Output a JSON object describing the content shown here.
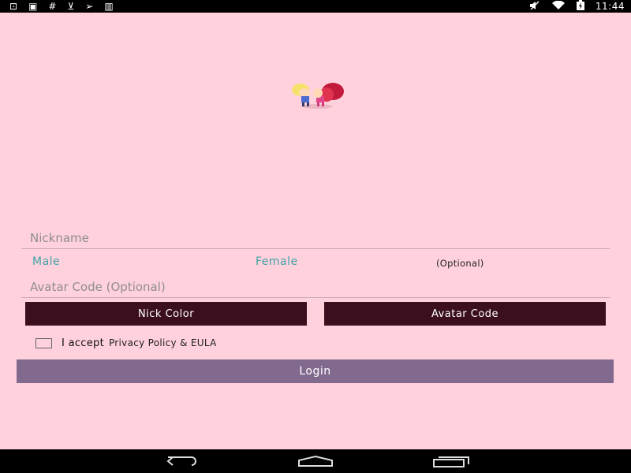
{
  "status_bar": {
    "left_icons": [
      "gamepad-icon",
      "image-icon",
      "hash-icon",
      "download-icon",
      "send-icon",
      "barcode-icon"
    ],
    "left_glyphs": [
      "⊡",
      "▣",
      "#",
      "⊻",
      "➢",
      "▥"
    ],
    "right_icons": [
      "mute-icon",
      "wifi-icon",
      "battery-charging-icon"
    ],
    "right_glyphs": [
      "🔇",
      "◠",
      "▮"
    ],
    "time": "11:44"
  },
  "form": {
    "nickname_placeholder": "Nickname",
    "gender_male": "Male",
    "gender_female": "Female",
    "gender_optional": "(Optional)",
    "avatar_code_placeholder": "Avatar Code (Optional)",
    "nick_color_label": "Nick Color",
    "avatar_code_label": "Avatar Code",
    "accept_label": "I accept",
    "policy_link": "Privacy Policy & EULA",
    "login_label": "Login"
  },
  "colors": {
    "background": "#ffd1dc",
    "dark_button": "#3c0f1f",
    "login_button": "#826a8e",
    "gender_accent": "#3fa3a8"
  }
}
